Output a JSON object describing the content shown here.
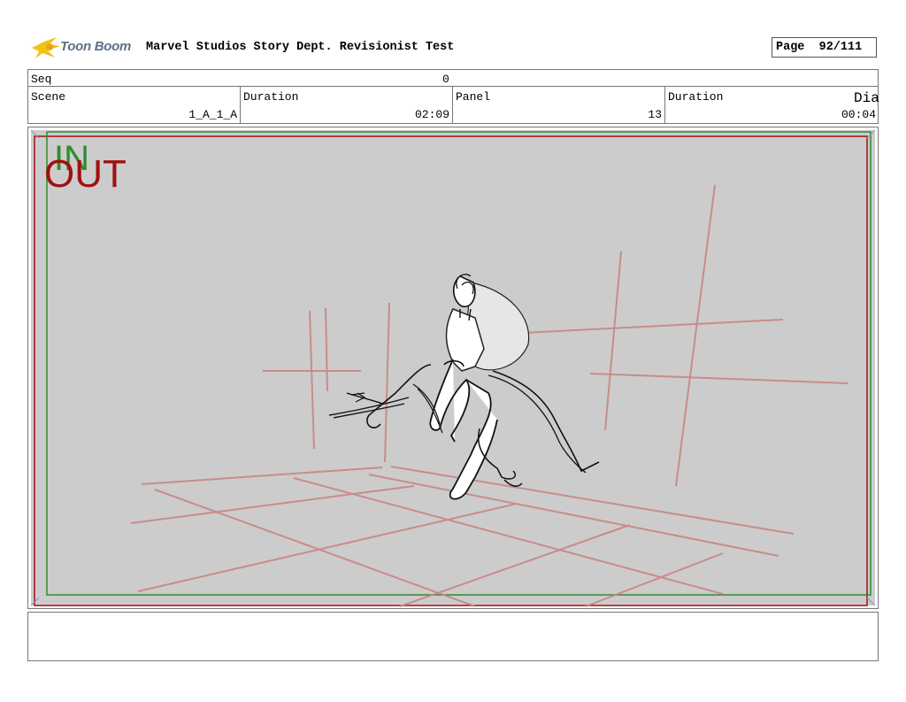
{
  "header": {
    "logo_text": "Toon Boom",
    "title": "Marvel Studios Story Dept. Revisionist Test",
    "page_label": "Page",
    "page_value": "92/111"
  },
  "seq": {
    "label": "Seq",
    "value": "0"
  },
  "info": {
    "scene_label": "Scene",
    "scene_value": "1_A_1_A",
    "duration_label": "Duration",
    "duration_value": "02:09",
    "panel_label": "Panel",
    "panel_value": "13",
    "panel_duration_label": "Duration",
    "panel_duration_value": "00:04",
    "dialog_label": "Dia"
  },
  "frame": {
    "in_label": "IN",
    "out_label": "OUT",
    "in_color": "#2e8b2e",
    "out_color": "#a01010",
    "background": "#cccccc"
  },
  "dialog_text": ""
}
